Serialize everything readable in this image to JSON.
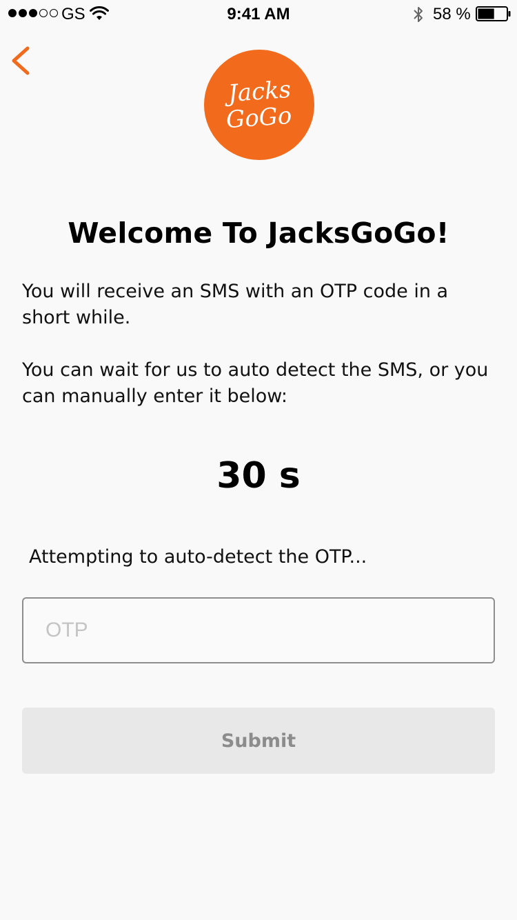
{
  "status_bar": {
    "carrier": "GS",
    "time": "9:41 AM",
    "battery_percent": "58 %",
    "battery_level": 0.58,
    "signal_bars_filled": 3,
    "signal_bars_total": 5,
    "icons": [
      "signal-dots-icon",
      "wifi-icon",
      "bluetooth-icon",
      "battery-icon"
    ]
  },
  "nav": {
    "back_icon": "chevron-left-icon",
    "accent_color": "#f26a1b"
  },
  "logo": {
    "line1": "Jacks",
    "line2": "GoGo",
    "color": "#f26a1b"
  },
  "content": {
    "title": "Welcome To JacksGoGo!",
    "paragraph1": "You will receive an SMS with an OTP code in a short while.",
    "paragraph2": "You can wait for us to auto detect the SMS, or you can manually enter it below:",
    "countdown": "30 s",
    "detect_status": "Attempting to auto-detect the OTP..."
  },
  "form": {
    "otp_placeholder": "OTP",
    "otp_value": "",
    "submit_label": "Submit"
  }
}
